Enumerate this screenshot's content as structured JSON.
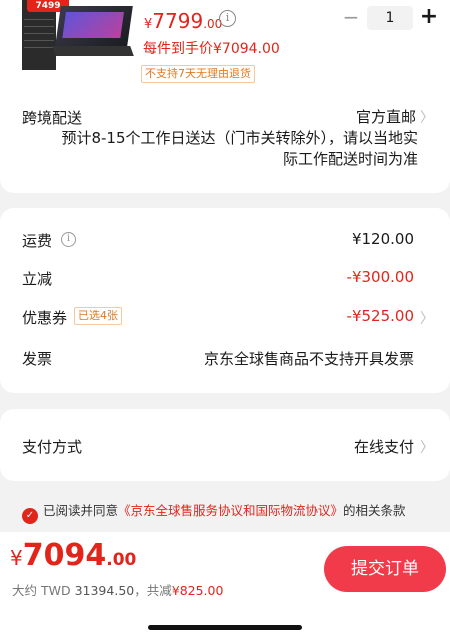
{
  "product": {
    "thumb_price_tag": "7499",
    "price_currency": "¥",
    "price_integer": "7799",
    "price_decimal": ".00",
    "hand_price": "每件到手价¥7094.00",
    "no_return": "不支持7天无理由退货",
    "quantity": "1"
  },
  "shipping": {
    "label": "跨境配送",
    "value": "官方直邮",
    "desc": "预计8-15个工作日送达（门市关转除外），请以当地实际工作配送时间为准"
  },
  "fees": {
    "freight_label": "运费",
    "freight_value": "¥120.00",
    "discount_label": "立减",
    "discount_value": "-¥300.00",
    "coupon_label": "优惠券",
    "coupon_badge": "已选4张",
    "coupon_value": "-¥525.00",
    "invoice_label": "发票",
    "invoice_value": "京东全球售商品不支持开具发票"
  },
  "payment": {
    "label": "支付方式",
    "value": "在线支付"
  },
  "agreement": {
    "prefix": "已阅读并同意",
    "link": "《京东全球售服务协议和国际物流协议》",
    "suffix": "的相关条款"
  },
  "footer": {
    "currency": "¥",
    "total_integer": "7094",
    "total_decimal": ".00",
    "twd_prefix": "大约 TWD ",
    "twd_value": "31394.50",
    "saved_prefix": "，共减",
    "saved_value": "¥825.00",
    "submit_label": "提交订单"
  },
  "colors": {
    "accent": "#e1251b",
    "submit_bg": "#f23b4a"
  },
  "icons": [
    "info-icon",
    "chevron-right-icon",
    "check-circle-icon"
  ]
}
